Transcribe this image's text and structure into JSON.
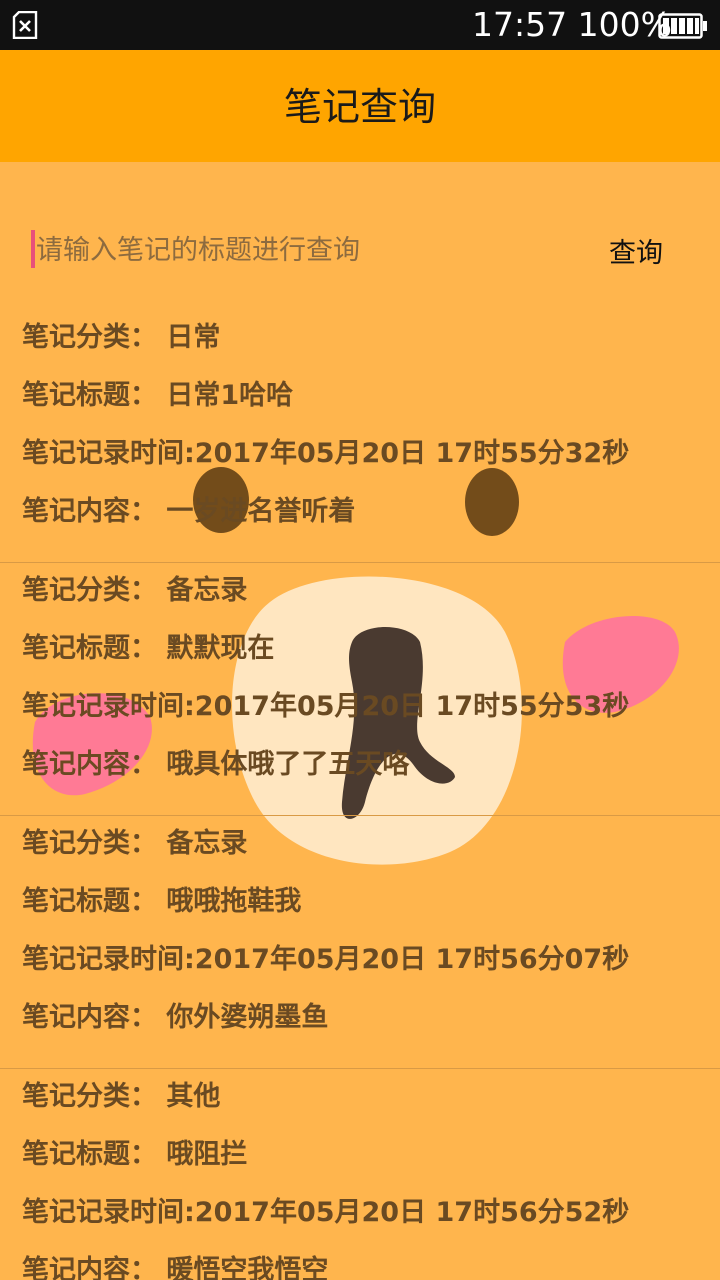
{
  "status_bar": {
    "time_battery": "17:57 100%",
    "icons": [
      "sim-card-error-icon",
      "battery-full-icon"
    ]
  },
  "app_bar": {
    "title": "笔记查询"
  },
  "search": {
    "placeholder": "请输入笔记的标题进行查询",
    "value": "",
    "button_label": "查询"
  },
  "notes": [
    {
      "category": "笔记分类：  日常",
      "title": "笔记标题：  日常1哈哈",
      "time": "笔记记录时间:2017年05月20日 17时55分32秒",
      "content": "笔记内容：  一岁进名誉听着"
    },
    {
      "category": "笔记分类：  备忘录",
      "title": "笔记标题：  默默现在",
      "time": "笔记记录时间:2017年05月20日 17时55分53秒",
      "content": "笔记内容：  哦具体哦了了五天咯"
    },
    {
      "category": "笔记分类：  备忘录",
      "title": "笔记标题：  哦哦拖鞋我",
      "time": "笔记记录时间:2017年05月20日 17时56分07秒",
      "content": "笔记内容：  你外婆朔墨鱼"
    },
    {
      "category": "笔记分类：  其他",
      "title": "笔记标题：  哦阻拦",
      "time": "笔记记录时间:2017年05月20日 17时56分52秒",
      "content": "笔记内容：  暖悟空我悟空"
    }
  ],
  "colors": {
    "background": "#ffb54d",
    "app_bar": "#ffa500",
    "status_bar": "#111111",
    "note_text": "#6a4a22",
    "caret": "#e8507a"
  }
}
